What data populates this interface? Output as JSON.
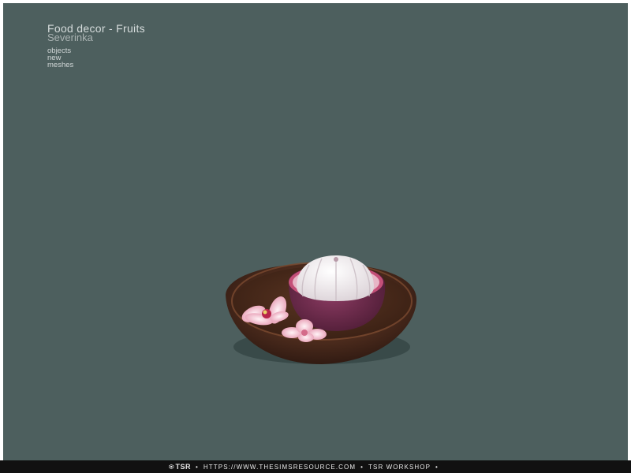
{
  "header": {
    "title": "Food decor - Fruits",
    "author": "Severinka",
    "tags": [
      "objects",
      "new",
      "meshes"
    ]
  },
  "footer": {
    "logo_text": "TSR",
    "separator": "•",
    "url": "HTTPS://WWW.THESIMSRESOURCE.COM",
    "workshop": "TSR WORKSHOP"
  },
  "colors": {
    "background": "#4d5f5e",
    "bowl": "#4a2a1c",
    "fruit_shell": "#6b2a4a",
    "fruit_flesh": "#f2eef0",
    "petals": "#f2b9c8",
    "footer": "#111111"
  },
  "image": {
    "subject": "wooden bowl with mangosteen and orchid flowers"
  }
}
